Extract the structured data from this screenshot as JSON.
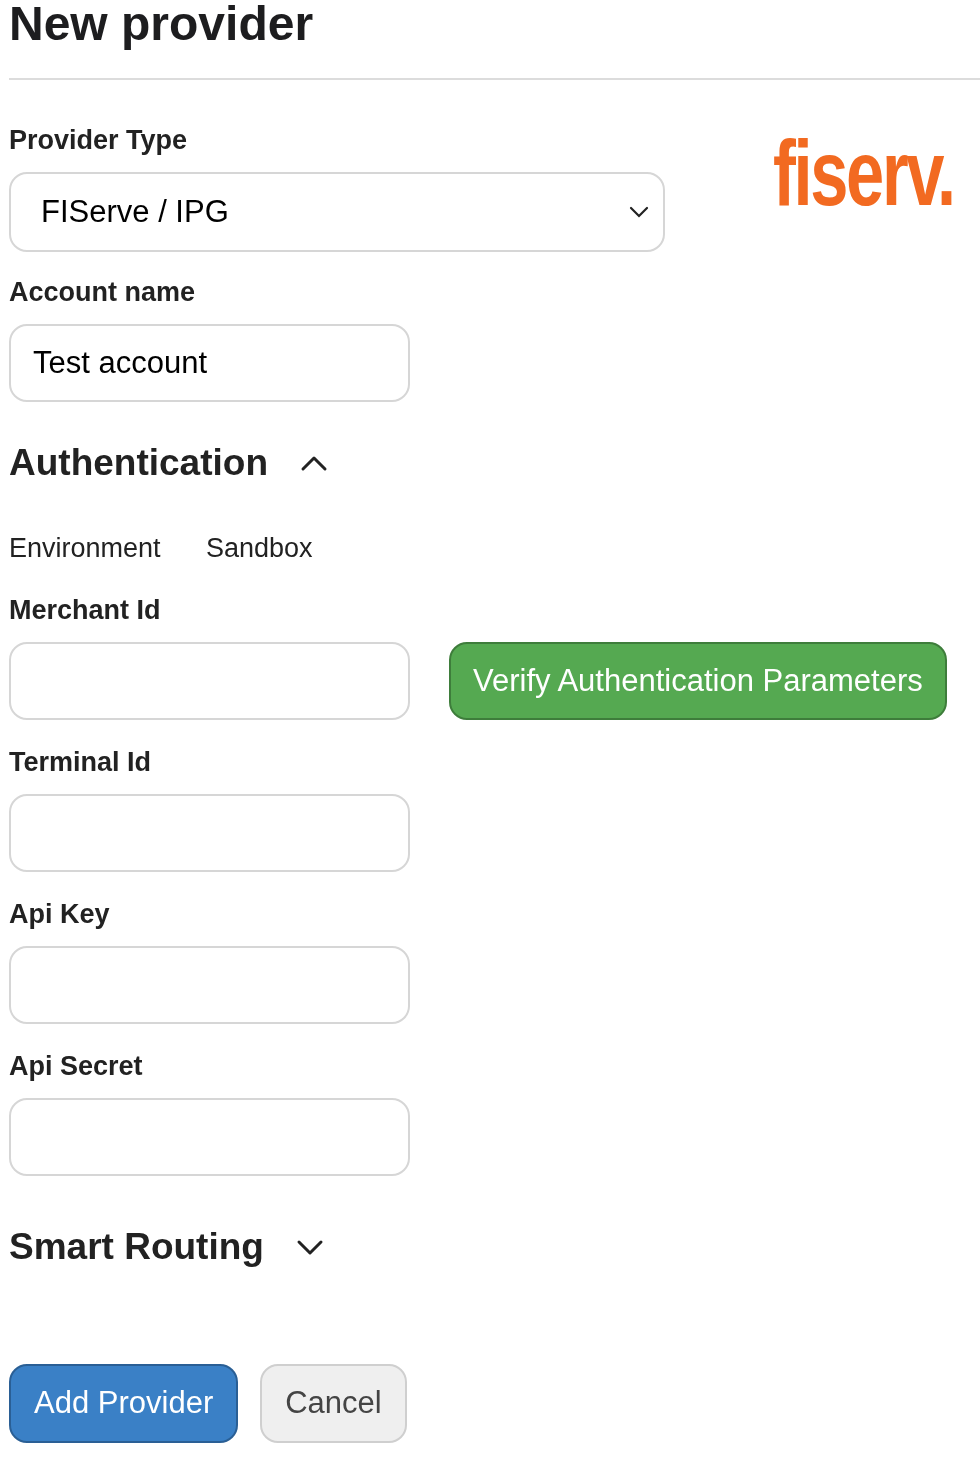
{
  "page": {
    "title": "New provider"
  },
  "provider_type": {
    "label": "Provider Type",
    "value": "FIServe / IPG"
  },
  "logo": {
    "text": "fiserv."
  },
  "account_name": {
    "label": "Account name",
    "value": "Test account"
  },
  "authentication": {
    "title": "Authentication",
    "expanded": true,
    "environment": {
      "label": "Environment",
      "value": "Sandbox"
    },
    "fields": [
      {
        "label": "Merchant Id"
      },
      {
        "label": "Terminal Id"
      },
      {
        "label": "Api Key"
      },
      {
        "label": "Api Secret"
      }
    ],
    "verify_button": "Verify Authentication Parameters"
  },
  "smart_routing": {
    "title": "Smart Routing",
    "expanded": false
  },
  "buttons": [
    {
      "label": "Add Provider",
      "kind": "primary"
    },
    {
      "label": "Cancel",
      "kind": "secondary"
    }
  ]
}
